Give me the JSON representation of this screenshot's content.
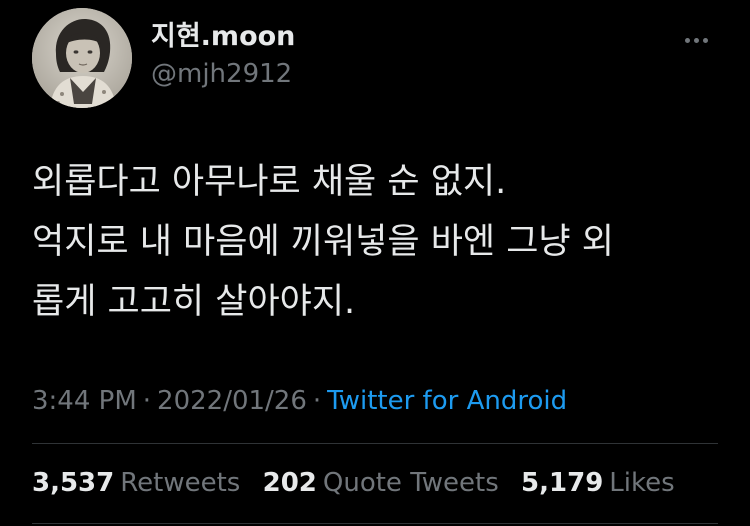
{
  "user": {
    "display_name": "지현.moon",
    "handle": "@mjh2912"
  },
  "tweet": {
    "lines": [
      "외롭다고 아무나로 채울 순 없지.",
      "억지로 내 마음에 끼워넣을 바엔 그냥 외",
      "롭게 고고히 살아야지."
    ],
    "time": "3:44 PM",
    "date": "2022/01/26",
    "separator": "·",
    "source": "Twitter for Android"
  },
  "stats": {
    "retweets_count": "3,537",
    "retweets_label": "Retweets",
    "quotes_count": "202",
    "quotes_label": "Quote Tweets",
    "likes_count": "5,179",
    "likes_label": "Likes"
  },
  "colors": {
    "background": "#000000",
    "primary_text": "#e7e9ea",
    "secondary_text": "#71767b",
    "link": "#1d9bf0",
    "divider": "#2f3336"
  }
}
